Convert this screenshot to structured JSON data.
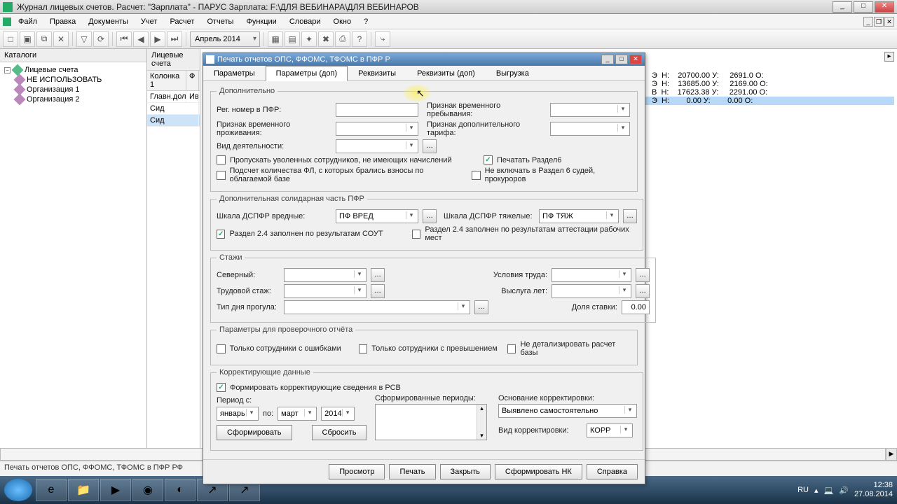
{
  "window": {
    "title": "Журнал лицевых счетов. Расчет: \"Зарплата\" - ПАРУС Зарплата: F:\\ДЛЯ ВЕБИНАРА\\ДЛЯ ВЕБИНАРОВ"
  },
  "menu": [
    "Файл",
    "Правка",
    "Документы",
    "Учет",
    "Расчет",
    "Отчеты",
    "Функции",
    "Словари",
    "Окно",
    "?"
  ],
  "toolbar": {
    "period": "Апрель 2014"
  },
  "left_panel": {
    "title": "Каталоги",
    "root": "Лицевые счета",
    "items": [
      "НЕ ИСПОЛЬЗОВАТЬ",
      "Организация 1",
      "Организация 2"
    ]
  },
  "mid_panel": {
    "title": "Лицевые счета",
    "col": "Колонка 1",
    "col2": "Ф",
    "rows": [
      "Главн.дол:",
      "Ив.",
      "Сид",
      "Сид"
    ],
    "selected": 3
  },
  "data_grid": {
    "lines": [
      "Э  Н:    20700.00 У:     2691.0 О:",
      "Э  Н:    13685.00 У:     2169.00 О:",
      "В  Н:    17623.38 У:     2291.00 О:",
      "Э  Н:        0.00 У:        0.00 О:"
    ],
    "selected": 3
  },
  "dialog": {
    "title": "Печать отчетов ОПС, ФФОМС, ТФОМС в ПФР Р",
    "tabs": [
      "Параметры",
      "Параметры (доп)",
      "Реквизиты",
      "Реквизиты (доп)",
      "Выгрузка"
    ],
    "active_tab": 1,
    "group_extra": "Дополнительно",
    "lbl_reg_pfr": "Рег. номер в ПФР:",
    "lbl_temp_stay": "Признак временного пребывания:",
    "lbl_temp_live": "Признак временного проживания:",
    "lbl_extra_tariff": "Признак дополнительного тарифа:",
    "lbl_activity": "Вид деятельности:",
    "chk_skip_fired": "Пропускать уволенных сотрудников, не имеющих начислений",
    "chk_print_r6": "Печатать Раздел6",
    "chk_count_fl": "Подсчет количества ФЛ, с которых брались взносы по облагаемой базе",
    "chk_exclude_judges": "Не включать в Раздел 6 судей, прокуроров",
    "group_solidar": "Дополнительная солидарная часть ПФР",
    "lbl_dspfr_harm": "Шкала ДСПФР вредные:",
    "val_dspfr_harm": "ПФ ВРЕД",
    "lbl_dspfr_heavy": "Шкала ДСПФР тяжелые:",
    "val_dspfr_heavy": "ПФ ТЯЖ",
    "chk_24_sout": "Раздел 2.4 заполнен по результатам СОУТ",
    "chk_24_attest": "Раздел 2.4 заполнен по результатам аттестации рабочих мест",
    "group_stazh": "Стажи",
    "lbl_north": "Северный:",
    "lbl_work_cond": "Условия труда:",
    "lbl_trud": "Трудовой стаж:",
    "lbl_vysluga": "Выслуга лет:",
    "lbl_skip_type": "Тип дня прогула:",
    "lbl_share": "Доля ставки:",
    "val_share": "0.00",
    "group_check": "Параметры для проверочного отчёта",
    "chk_only_err": "Только сотрудники с ошибками",
    "chk_only_exceed": "Только сотрудники с превышением",
    "chk_no_detail": "Не детализировать расчет базы",
    "group_corr": "Корректирующие данные",
    "chk_form_rsv": "Формировать корректирующие сведения в РСВ",
    "lbl_period_from": "Период с:",
    "val_month_from": "январь",
    "lbl_to": "по:",
    "val_month_to": "март",
    "val_year": "2014",
    "lbl_formed": "Сформированные периоды:",
    "lbl_basis": "Основание корректировки:",
    "val_basis": "Выявлено самостоятельно",
    "lbl_corr_type": "Вид корректировки:",
    "val_corr_type": "КОРР",
    "btn_form": "Сформировать",
    "btn_reset": "Сбросить",
    "footer": [
      "Просмотр",
      "Печать",
      "Закрыть",
      "Сформировать НК",
      "Справка"
    ]
  },
  "statusbar": "Печать отчетов ОПС, ФФОМС, ТФОМС в ПФР РФ",
  "taskbar": {
    "lang": "RU",
    "time": "12:38",
    "date": "27.08.2014"
  }
}
